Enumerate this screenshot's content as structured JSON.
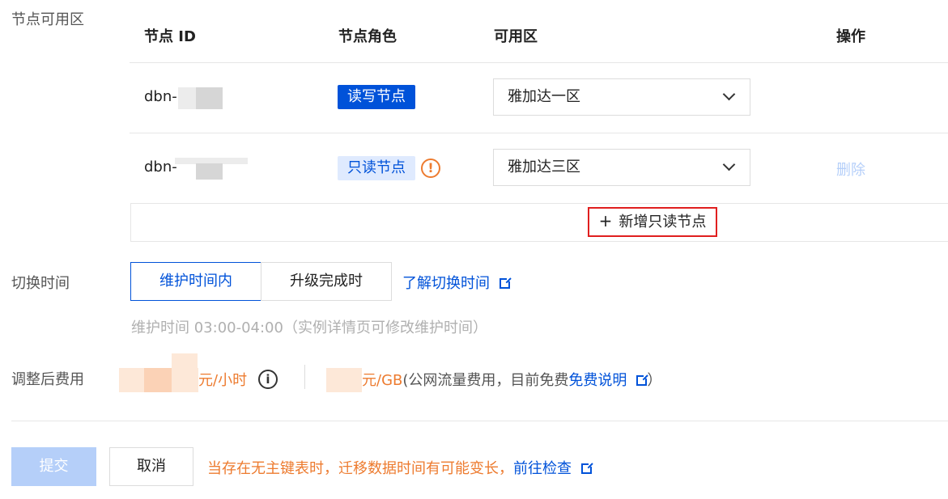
{
  "zone_section": {
    "label": "节点可用区",
    "columns": [
      "节点 ID",
      "节点角色",
      "可用区",
      "操作"
    ],
    "rows": [
      {
        "id_prefix": "dbn-i",
        "role": "读写节点",
        "zone": "雅加达一区",
        "action": ""
      },
      {
        "id_prefix": "dbn-",
        "role": "只读节点",
        "zone": "雅加达三区",
        "action": "删除"
      }
    ],
    "add_button": {
      "icon": "plus-icon",
      "label": "新增只读节点"
    }
  },
  "switch_section": {
    "label": "切换时间",
    "options": [
      "维护时间内",
      "升级完成时"
    ],
    "selected": "维护时间内",
    "learn_link": "了解切换时间",
    "hint": "维护时间 03:00-04:00（实例详情页可修改维护时间）"
  },
  "fee_section": {
    "label": "调整后费用",
    "unit_hour": "元/小时",
    "unit_gb": "元/GB",
    "gb_note_open": "(公网流量费用，目前免费",
    "free_link": "免费说明",
    "gb_note_close": "）"
  },
  "footer": {
    "submit": "提交",
    "cancel": "取消",
    "warning": "当存在无主键表时，迁移数据时间有可能变长，",
    "check_link": "前往检查"
  },
  "colors": {
    "primary": "#0052d9",
    "warning": "#ed7b2f",
    "highlight_border": "#e01f1f"
  }
}
